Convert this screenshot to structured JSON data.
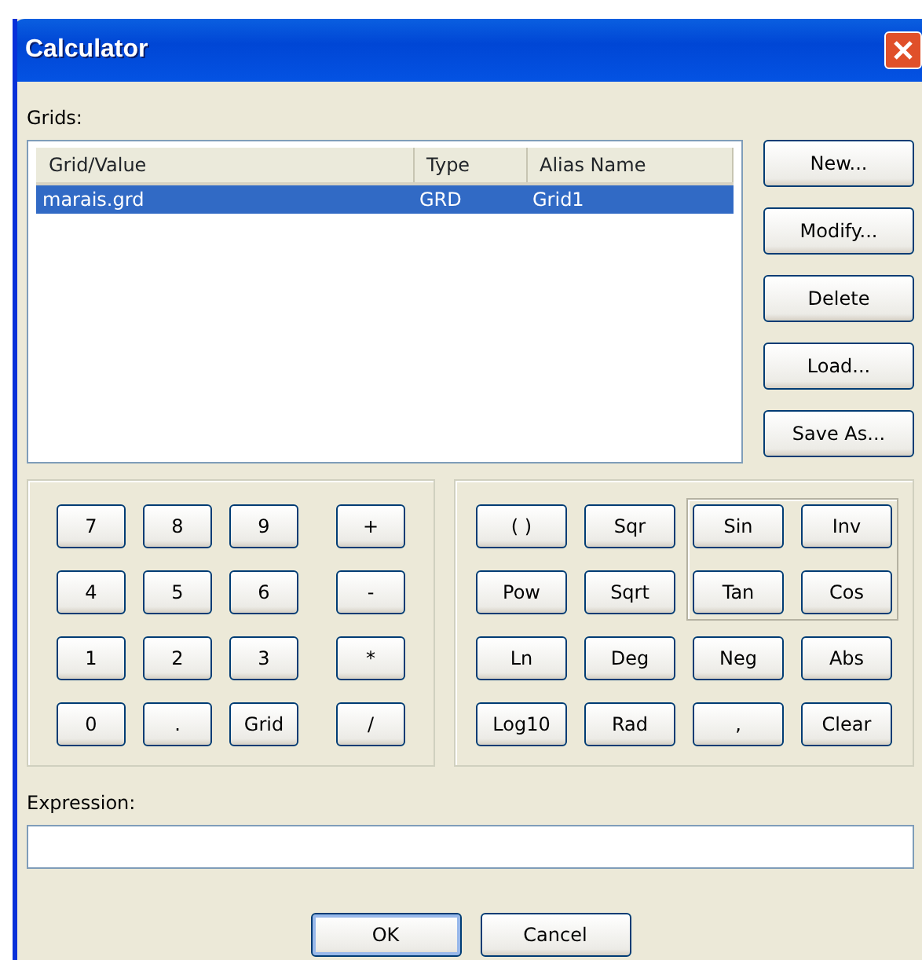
{
  "window": {
    "title": "Calculator"
  },
  "grids": {
    "label": "Grids:",
    "columns": [
      "Grid/Value",
      "Type",
      "Alias Name"
    ],
    "rows": [
      {
        "cells": [
          "marais.grd",
          "GRD",
          "Grid1"
        ],
        "selected": true
      }
    ]
  },
  "grid_buttons": [
    "New...",
    "Modify...",
    "Delete",
    "Load...",
    "Save As..."
  ],
  "keypad": [
    [
      "7",
      "8",
      "9",
      "+"
    ],
    [
      "4",
      "5",
      "6",
      "-"
    ],
    [
      "1",
      "2",
      "3",
      "*"
    ],
    [
      "0",
      ".",
      "Grid",
      "/"
    ]
  ],
  "function_keys": {
    "upper_left": [
      [
        "( )",
        "Sqr"
      ],
      [
        "Pow",
        "Sqrt"
      ]
    ],
    "trig_group": [
      [
        "Sin",
        "Inv"
      ],
      [
        "Tan",
        "Cos"
      ]
    ],
    "lower": [
      [
        "Ln",
        "Deg",
        "Neg",
        "Abs"
      ],
      [
        "Log10",
        "Rad",
        ",",
        "Clear"
      ]
    ]
  },
  "expression": {
    "label": "Expression:"
  },
  "dialog_buttons": [
    "OK",
    "Cancel"
  ]
}
